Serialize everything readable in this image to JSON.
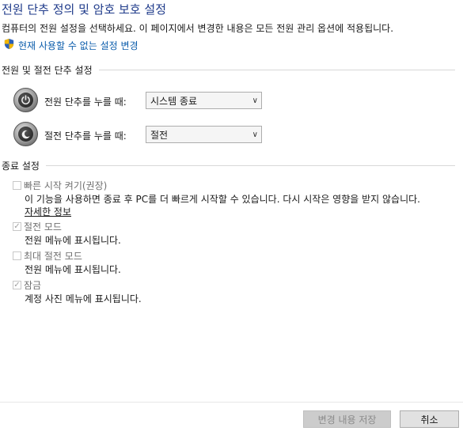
{
  "page": {
    "title": "전원 단추 정의 및 암호 보호 설정",
    "subtitle": "컴퓨터의 전원 설정을 선택하세요. 이 페이지에서 변경한 내용은 모든 전원 관리 옵션에 적용됩니다.",
    "admin_link": "현재 사용할 수 없는 설정 변경"
  },
  "power_buttons": {
    "heading": "전원 및 절전 단추 설정",
    "power_label": "전원 단추를 누를 때:",
    "power_value": "시스템 종료",
    "sleep_label": "절전 단추를 누를 때:",
    "sleep_value": "절전"
  },
  "shutdown": {
    "heading": "종료 설정",
    "fast_startup": {
      "label": "빠른 시작 켜기(권장)",
      "checked": false,
      "desc": "이 기능을 사용하면 종료 후 PC를 더 빠르게 시작할 수 있습니다. 다시 시작은 영향을 받지 않습니다.",
      "more": "자세한 정보"
    },
    "sleep": {
      "label": "절전 모드",
      "checked": true,
      "desc": "전원 메뉴에 표시됩니다."
    },
    "hibernate": {
      "label": "최대 절전 모드",
      "checked": false,
      "desc": "전원 메뉴에 표시됩니다."
    },
    "lock": {
      "label": "잠금",
      "checked": true,
      "desc": "계정 사진 메뉴에 표시됩니다."
    }
  },
  "footer": {
    "save": "변경 내용 저장",
    "cancel": "취소"
  },
  "colors": {
    "title": "#1e3a8a",
    "link": "#0b5cab",
    "disabled_text": "#707070"
  }
}
